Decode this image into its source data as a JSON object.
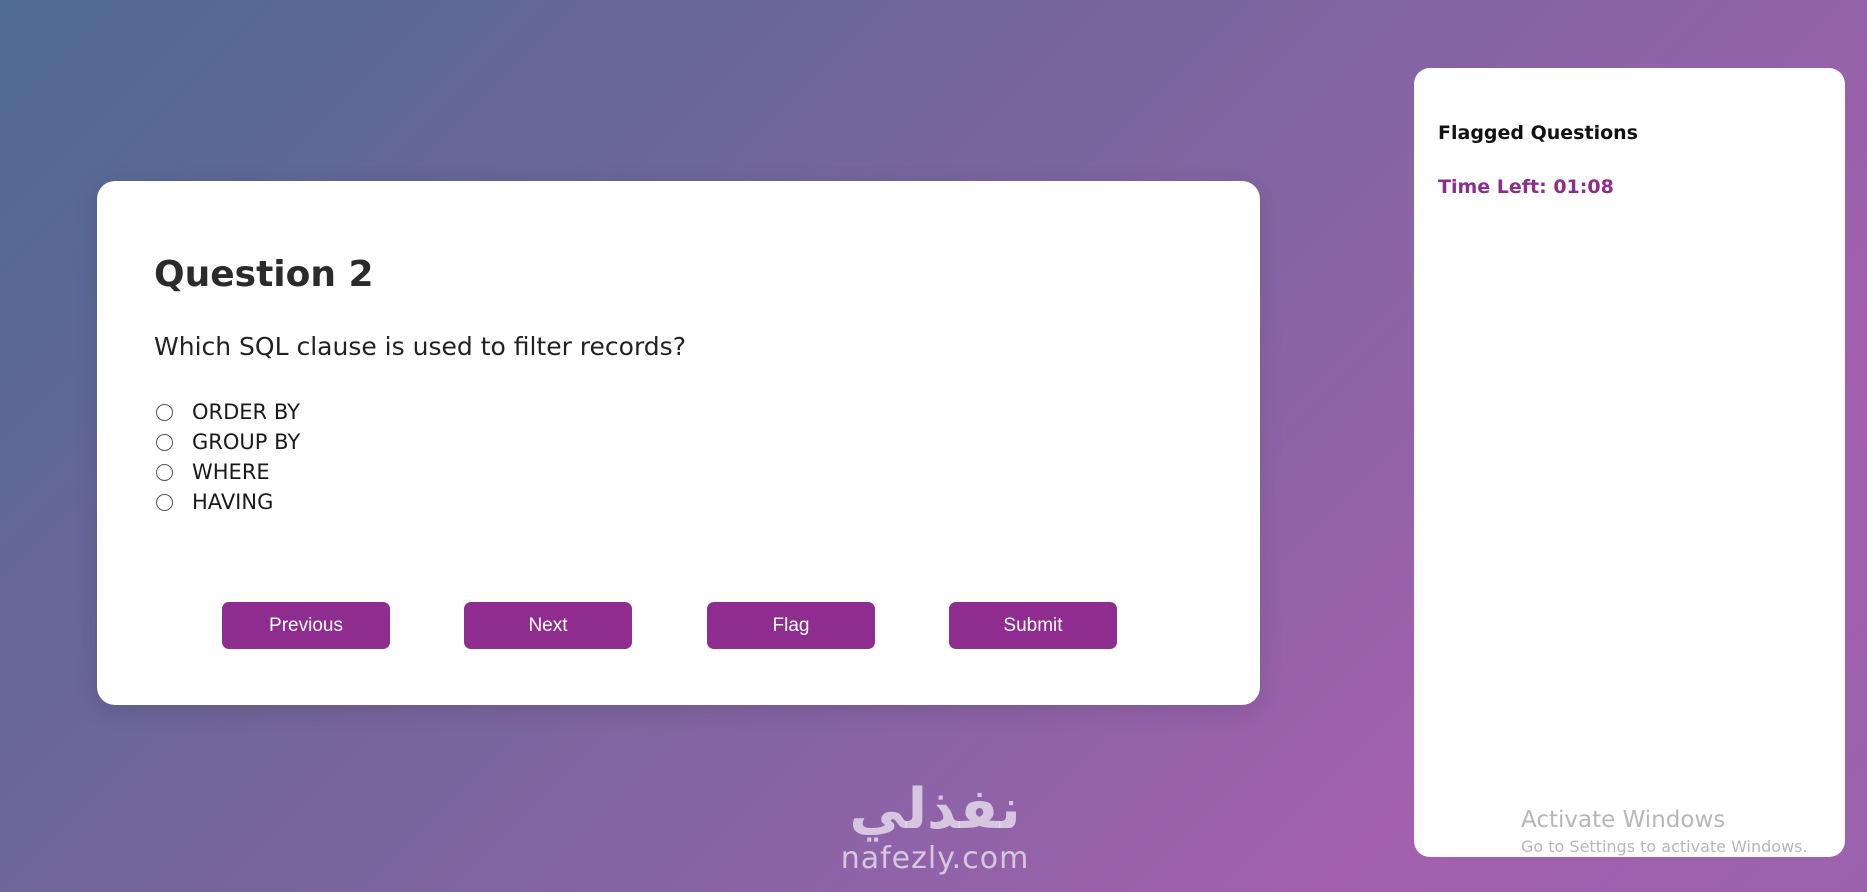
{
  "quiz": {
    "question_title": "Question 2",
    "question_text": "Which SQL clause is used to filter records?",
    "options": [
      {
        "label": "ORDER BY",
        "selected": false
      },
      {
        "label": "GROUP BY",
        "selected": false
      },
      {
        "label": "WHERE",
        "selected": false
      },
      {
        "label": "HAVING",
        "selected": false
      }
    ],
    "buttons": {
      "previous": "Previous",
      "next": "Next",
      "flag": "Flag",
      "submit": "Submit"
    }
  },
  "sidebar": {
    "title": "Flagged Questions",
    "timer": "Time Left: 01:08"
  },
  "watermark": {
    "arabic": "نفذلي",
    "latin": "nafezly.com"
  },
  "os_overlay": {
    "title": "Activate Windows",
    "subtitle": "Go to Settings to activate Windows."
  },
  "colors": {
    "accent": "#8e2d8f",
    "card_bg": "#ffffff",
    "bg_start": "#4f6a93",
    "bg_end": "#a35fae"
  }
}
